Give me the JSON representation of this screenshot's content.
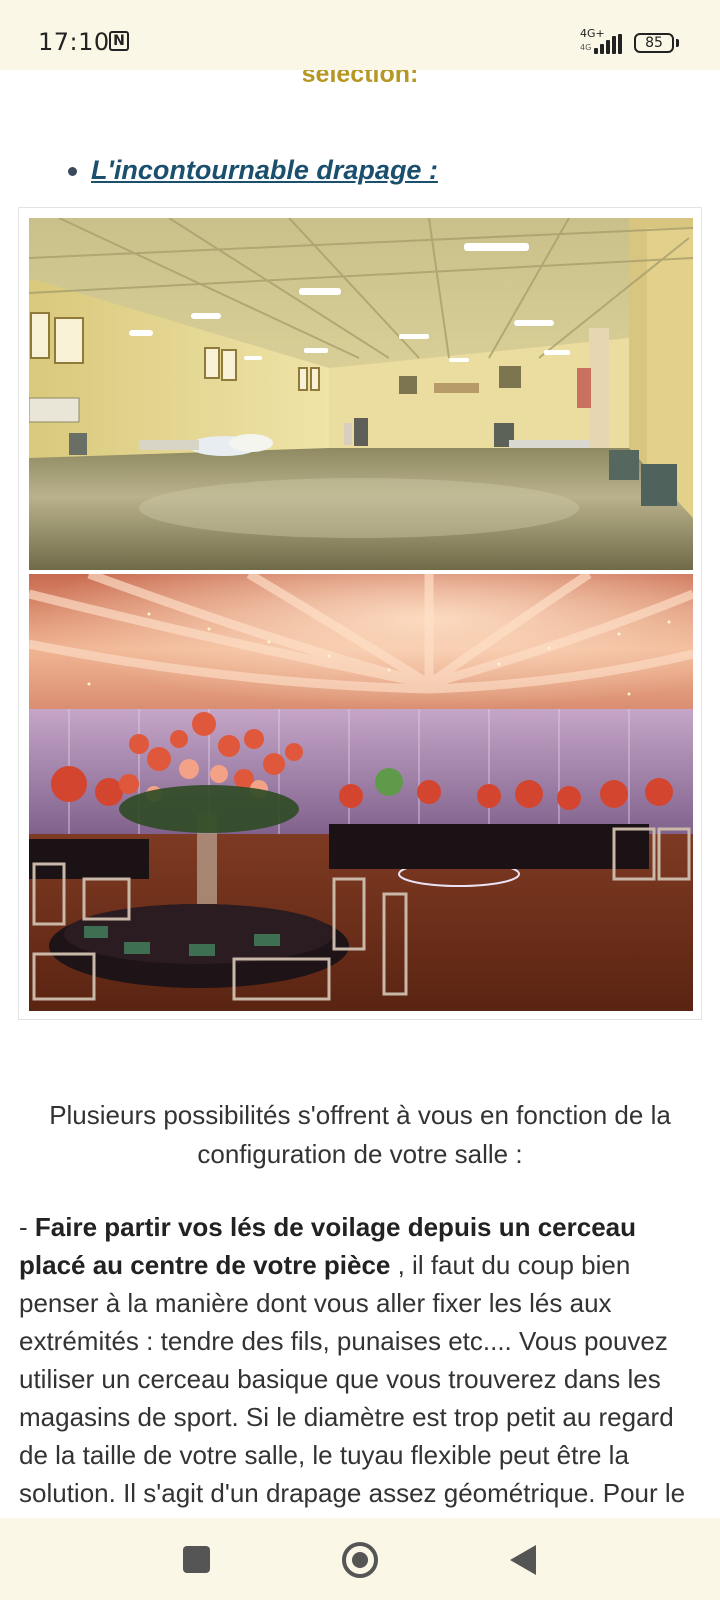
{
  "status_bar": {
    "time": "17:10",
    "nfc_icon": "N",
    "network": "4G+",
    "network_sub": "4G",
    "battery": "85"
  },
  "article": {
    "section_heading_fragment": "sélection:",
    "bullet_link": "L'incontournable drapage :",
    "image_before_icon": "empty-hall-photo",
    "image_after_icon": "draped-reception-hall-photo",
    "intro_paragraph": "Plusieurs possibilités s'offrent à vous en fonction de la configuration de votre salle :",
    "body_prefix": "- ",
    "body_bold": "Faire partir vos lés de voilage depuis un cerceau placé au centre de votre pièce",
    "body_rest": " , il faut du coup bien penser à la manière dont vous aller fixer les lés aux extrémités : tendre des fils, punaises etc.... Vous pouvez utiliser un cerceau basique que vous trouverez dans les magasins de sport. Si le diamètre est trop petit au regard de la taille de votre salle, le tuyau flexible peut être la solution. Il s'agit d'un drapage assez géométrique. Pour le réaliser sans"
  },
  "nav_bar": {
    "recent_icon": "square-recents-icon",
    "home_icon": "circle-home-icon",
    "back_icon": "triangle-back-icon"
  },
  "colors": {
    "heading_gold": "#b59722",
    "link_blue": "#1a4f6e",
    "system_bar_bg": "#fbf7e6"
  }
}
